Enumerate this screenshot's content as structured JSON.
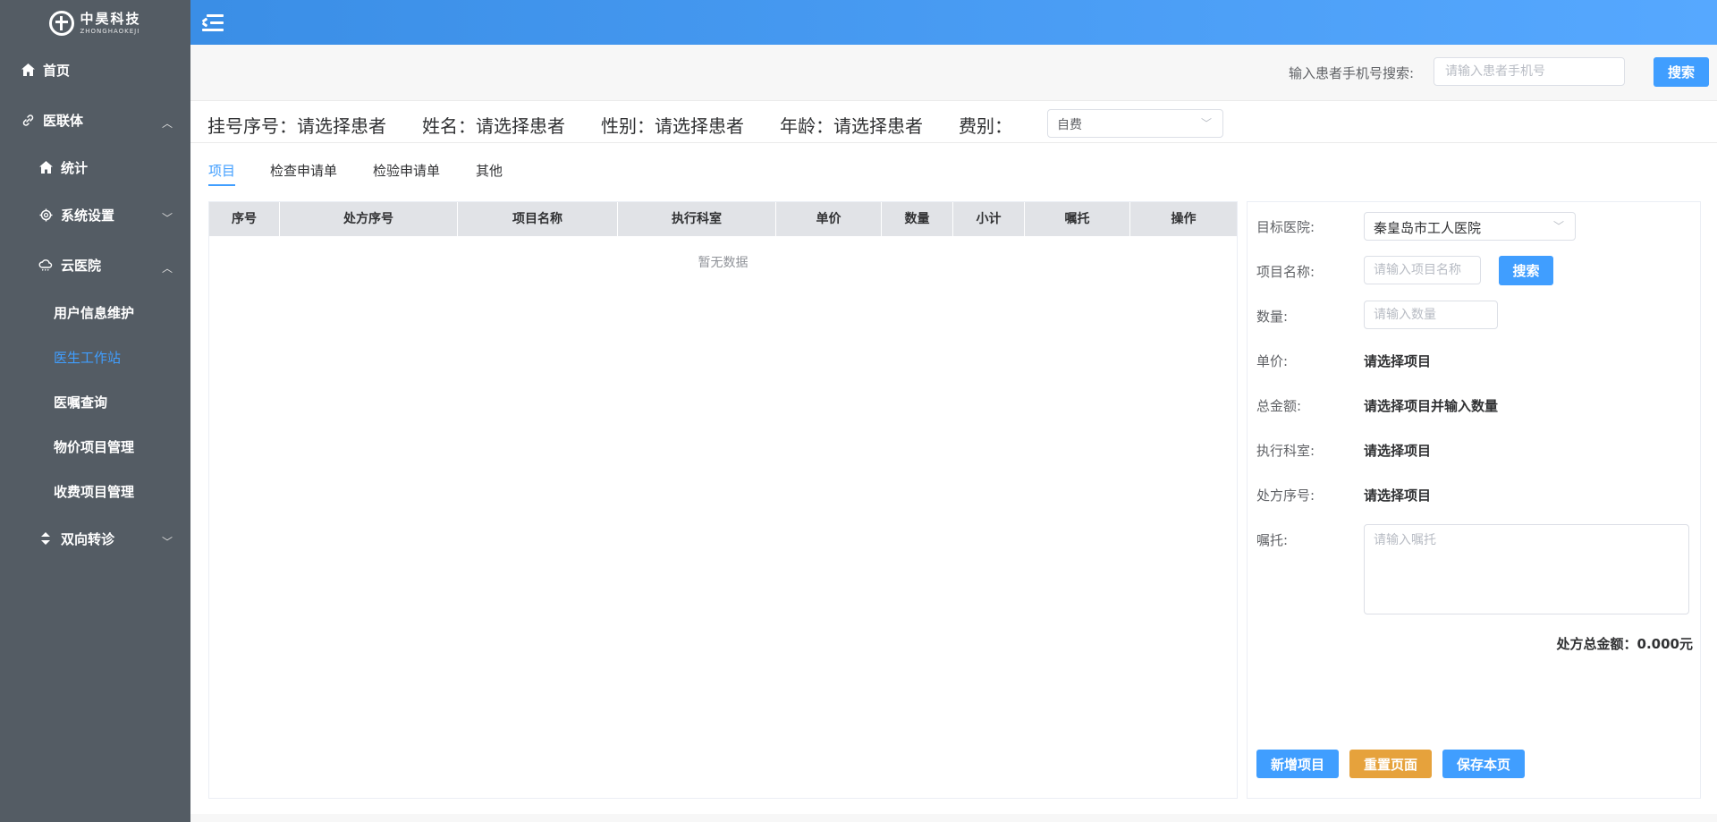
{
  "logo": {
    "name": "中昊科技",
    "subtitle": "ZHONGHAOKEJI"
  },
  "sidebar": {
    "items": [
      {
        "label": "首页",
        "icon": "home-icon"
      },
      {
        "label": "医联体",
        "icon": "link-icon"
      },
      {
        "label": "统计",
        "icon": "home-icon"
      },
      {
        "label": "系统设置",
        "icon": "gear-icon"
      },
      {
        "label": "云医院",
        "icon": "cloud-icon"
      },
      {
        "label": "用户信息维护"
      },
      {
        "label": "医生工作站"
      },
      {
        "label": "医嘱查询"
      },
      {
        "label": "物价项目管理"
      },
      {
        "label": "收费项目管理"
      },
      {
        "label": "双向转诊",
        "icon": "sort-icon"
      }
    ],
    "active_color": "#409eff"
  },
  "search": {
    "label": "输入患者手机号搜索:",
    "placeholder": "请输入患者手机号",
    "button": "搜索"
  },
  "patient": {
    "reg_no": "挂号序号：请选择患者",
    "name": "姓名：请选择患者",
    "gender": "性别：请选择患者",
    "age": "年龄：请选择患者",
    "fee_label": "费别：",
    "fee_value": "自费"
  },
  "tabs": [
    "项目",
    "检查申请单",
    "检验申请单",
    "其他"
  ],
  "table": {
    "columns": [
      "序号",
      "处方序号",
      "项目名称",
      "执行科室",
      "单价",
      "数量",
      "小计",
      "嘱托",
      "操作"
    ],
    "empty_text": "暂无数据"
  },
  "form": {
    "hospital_label": "目标医院:",
    "hospital_value": "秦皇岛市工人医院",
    "item_label": "项目名称:",
    "item_placeholder": "请输入项目名称",
    "item_search": "搜索",
    "qty_label": "数量:",
    "qty_placeholder": "请输入数量",
    "price_label": "单价:",
    "price_value": "请选择项目",
    "amount_label": "总金额:",
    "amount_value": "请选择项目并输入数量",
    "dept_label": "执行科室:",
    "dept_value": "请选择项目",
    "rx_label": "处方序号:",
    "rx_value": "请选择项目",
    "note_label": "嘱托:",
    "note_placeholder": "请输入嘱托",
    "total": "处方总金额：0.000元"
  },
  "actions": {
    "add": "新增项目",
    "reset": "重置页面",
    "save": "保存本页"
  },
  "colors": {
    "primary": "#409eff",
    "warning": "#e6a23c",
    "sidebar": "#545c64"
  }
}
